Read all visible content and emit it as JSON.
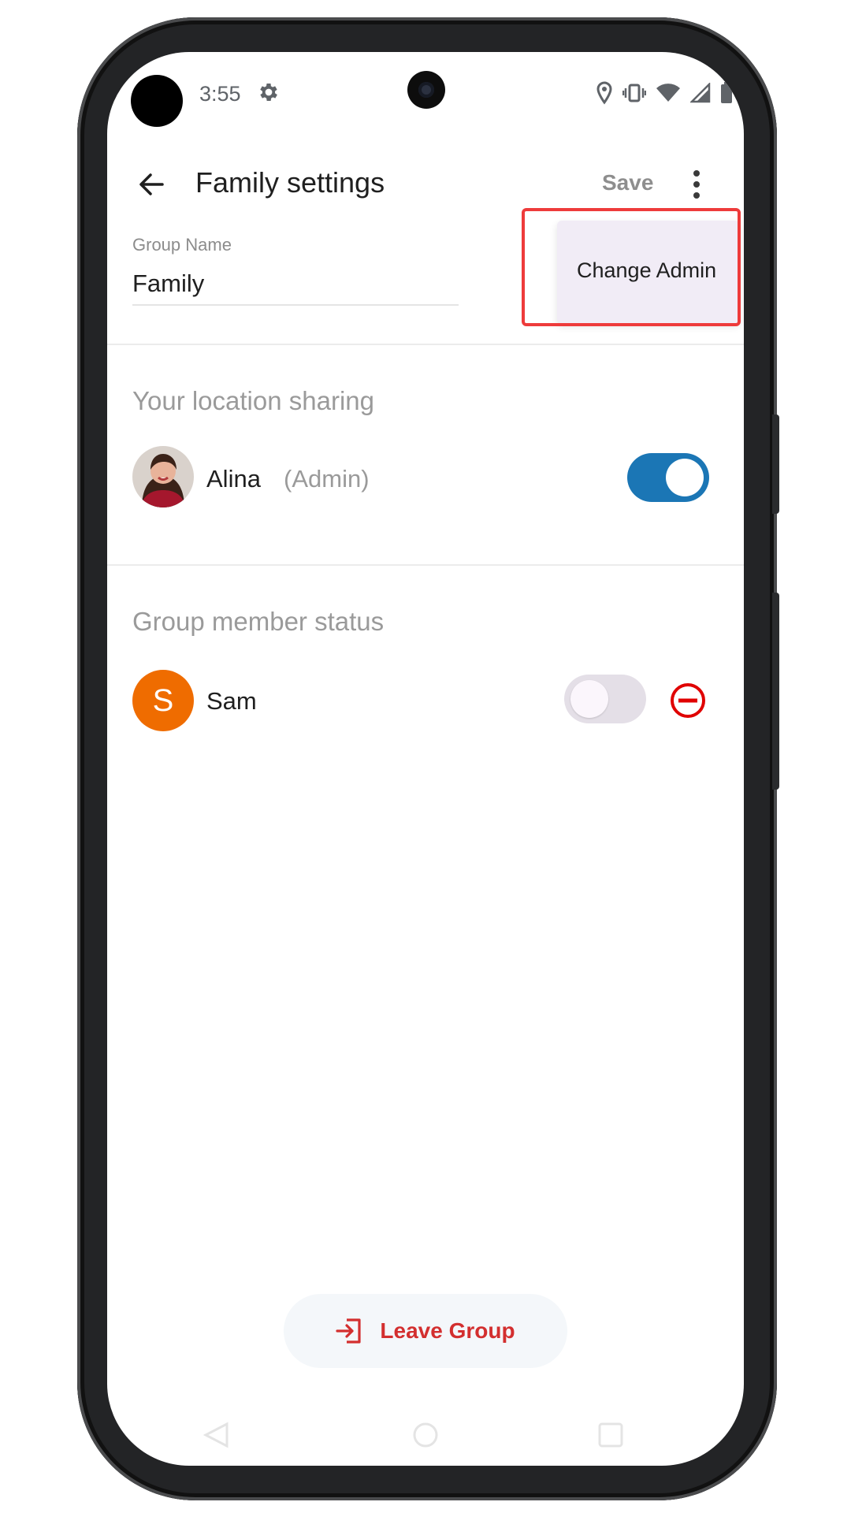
{
  "status_bar": {
    "time": "3:55",
    "icons": [
      "gear-icon",
      "location-pin-icon",
      "vibrate-icon",
      "wifi-icon",
      "signal-icon",
      "battery-icon"
    ]
  },
  "app_bar": {
    "title": "Family settings",
    "save_label": "Save",
    "back_icon": "arrow-back-icon",
    "overflow_icon": "more-vert-icon"
  },
  "group_name": {
    "label": "Group Name",
    "value": "Family"
  },
  "overflow_menu": {
    "items": [
      {
        "label": "Change Admin"
      }
    ]
  },
  "location_sharing": {
    "title": "Your location sharing",
    "member": {
      "name": "Alina",
      "role": "(Admin)",
      "sharing_on": true
    }
  },
  "member_status": {
    "title": "Group member status",
    "members": [
      {
        "name": "Sam",
        "initial": "S",
        "sharing_on": false,
        "avatar_color": "#ef6c00"
      }
    ]
  },
  "leave_button": {
    "label": "Leave Group",
    "icon": "exit-icon"
  },
  "colors": {
    "toggle_on": "#1b76b5",
    "danger": "#d32f2f",
    "menu_bg": "#f1ecf6",
    "highlight": "#ee3b3b"
  }
}
